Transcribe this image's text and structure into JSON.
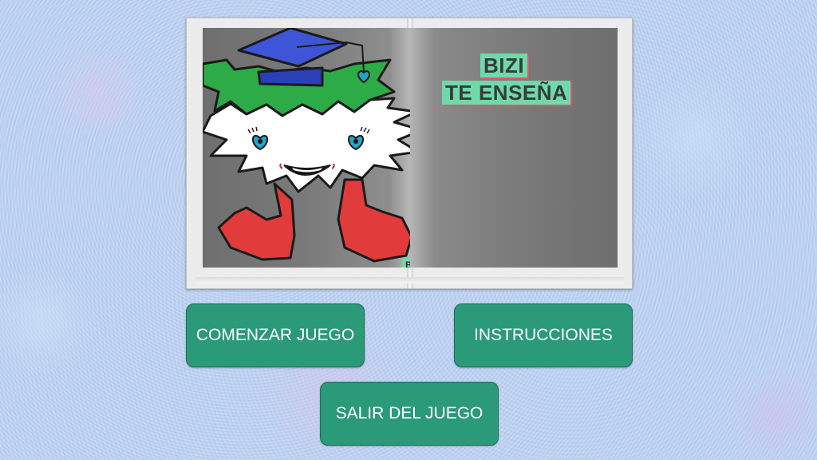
{
  "book": {
    "title_line1": "BIZI",
    "title_line2": "TE ENSEÑA",
    "badge": "BIZI"
  },
  "menu": {
    "start_label": "COMENZAR JUEGO",
    "instructions_label": "INSTRUCCIONES",
    "exit_label": "SALIR DEL JUEGO"
  },
  "colors": {
    "button": "#2a9a78",
    "title_highlight": "#6fd9ab",
    "title_shadow": "#e0576b",
    "background": "#b9d0f0"
  },
  "icons": [
    "bizi-mascot",
    "graduation-cap-icon",
    "heart-icon"
  ]
}
